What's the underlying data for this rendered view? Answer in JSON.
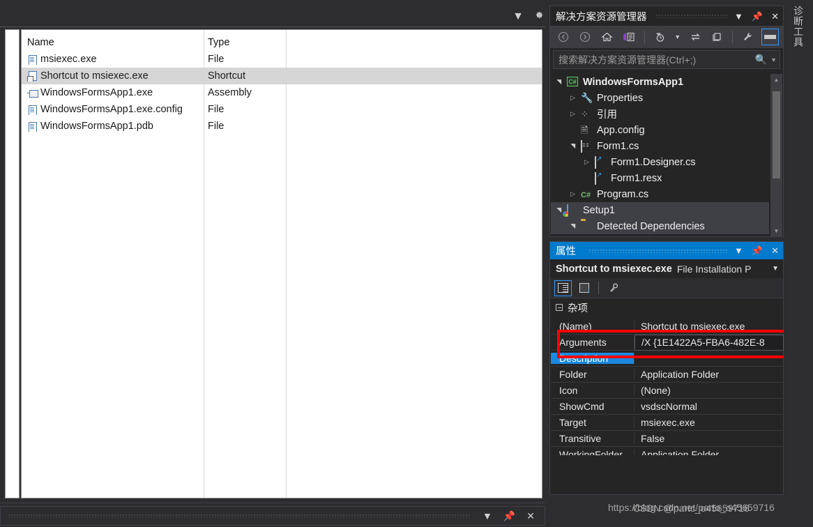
{
  "editor": {
    "columns": [
      "Name",
      "Type"
    ],
    "rows": [
      {
        "name": "msiexec.exe",
        "type": "File",
        "icon": "file-icon",
        "selected": false
      },
      {
        "name": "Shortcut to msiexec.exe",
        "type": "Shortcut",
        "icon": "shortcut-icon",
        "selected": true
      },
      {
        "name": "WindowsFormsApp1.exe",
        "type": "Assembly",
        "icon": "assembly-icon",
        "selected": false
      },
      {
        "name": "WindowsFormsApp1.exe.config",
        "type": "File",
        "icon": "file-icon",
        "selected": false
      },
      {
        "name": "WindowsFormsApp1.pdb",
        "type": "File",
        "icon": "file-icon",
        "selected": false
      }
    ]
  },
  "top_strip": {
    "dropdown_icon": "chevron-down-icon",
    "settings_icon": "gear-icon"
  },
  "bottom_bar": {
    "dropdown_icon": "chevron-down-icon",
    "pin_icon": "pin-icon",
    "close_icon": "close-icon"
  },
  "solution_explorer": {
    "title": "解决方案资源管理器",
    "title_icons": {
      "dropdown": "chevron-down-icon",
      "pin": "pin-icon",
      "close": "close-icon"
    },
    "toolbar": [
      {
        "name": "back-button",
        "glyph": "←"
      },
      {
        "name": "forward-button",
        "glyph": "→"
      },
      {
        "name": "home-button",
        "glyph": "home"
      },
      {
        "name": "solution-view-button",
        "glyph": "vs"
      },
      {
        "name": "pending-changes-button",
        "glyph": "clock"
      },
      {
        "name": "pending-changes-dropdown",
        "glyph": "▾"
      },
      {
        "name": "sync-with-active-document-button",
        "glyph": "⇆"
      },
      {
        "name": "refresh-button",
        "glyph": "copy"
      },
      {
        "name": "properties-button",
        "glyph": "wrench"
      },
      {
        "name": "preview-selected-items-button",
        "glyph": "bar"
      }
    ],
    "search_placeholder": "搜索解决方案资源管理器(Ctrl+;)",
    "search_icon": "search-icon",
    "search_dropdown_icon": "chevron-down-icon",
    "tree": [
      {
        "label": "WindowsFormsApp1",
        "indent": 0,
        "arrow": "expanded",
        "icon": "csharp-project-icon",
        "bold": true,
        "selected": false
      },
      {
        "label": "Properties",
        "indent": 1,
        "arrow": "collapsed",
        "icon": "wrench-icon",
        "bold": false,
        "selected": false
      },
      {
        "label": "引用",
        "indent": 1,
        "arrow": "collapsed",
        "icon": "references-icon",
        "bold": false,
        "selected": false
      },
      {
        "label": "App.config",
        "indent": 1,
        "arrow": "none",
        "icon": "config-file-icon",
        "bold": false,
        "selected": false
      },
      {
        "label": "Form1.cs",
        "indent": 1,
        "arrow": "expanded",
        "icon": "form-icon",
        "bold": false,
        "selected": false
      },
      {
        "label": "Form1.Designer.cs",
        "indent": 2,
        "arrow": "collapsed",
        "icon": "page-icon",
        "bold": false,
        "selected": false
      },
      {
        "label": "Form1.resx",
        "indent": 2,
        "arrow": "none",
        "icon": "page-icon",
        "bold": false,
        "selected": false
      },
      {
        "label": "Program.cs",
        "indent": 1,
        "arrow": "collapsed",
        "icon": "csharp-file-icon",
        "bold": false,
        "selected": false
      },
      {
        "label": "Setup1",
        "indent": 0,
        "arrow": "expanded",
        "icon": "setup-project-icon",
        "bold": false,
        "selected": true
      },
      {
        "label": "Detected Dependencies",
        "indent": 1,
        "arrow": "expanded",
        "icon": "folder-icon",
        "bold": false,
        "selected": true
      }
    ],
    "scrollbar": {
      "up_icon": "scroll-up-icon",
      "down_icon": "scroll-down-icon"
    }
  },
  "properties": {
    "title": "属性",
    "title_icons": {
      "dropdown": "chevron-down-icon",
      "pin": "pin-icon",
      "close": "close-icon"
    },
    "object_name": "Shortcut to msiexec.exe",
    "object_type": "File Installation P",
    "object_dropdown_icon": "chevron-down-icon",
    "toolbar": [
      {
        "name": "categorized-button",
        "glyph": "categorized"
      },
      {
        "name": "alphabetical-button",
        "glyph": "alphabetical"
      },
      {
        "name": "property-pages-button",
        "glyph": "key"
      }
    ],
    "category": "杂项",
    "category_expander_icon": "minus-box-icon",
    "rows": [
      {
        "key": "(Name)",
        "value": "Shortcut to msiexec.exe",
        "state": "normal"
      },
      {
        "key": "Arguments",
        "value": "/X {1E1422A5-FBA6-482E-8",
        "state": "editing"
      },
      {
        "key": "Description",
        "value": "",
        "state": "selected"
      },
      {
        "key": "Folder",
        "value": "Application Folder",
        "state": "normal"
      },
      {
        "key": "Icon",
        "value": "(None)",
        "state": "normal"
      },
      {
        "key": "ShowCmd",
        "value": "vsdscNormal",
        "state": "normal"
      },
      {
        "key": "Target",
        "value": "msiexec.exe",
        "state": "normal"
      },
      {
        "key": "Transitive",
        "value": "False",
        "state": "normal"
      },
      {
        "key": "WorkingFolder",
        "value": "Application Folder",
        "state": "normal"
      }
    ]
  },
  "vertical_tab": {
    "label": "诊断工具"
  },
  "watermarks": {
    "line1": "https://blog.csdn.net/parto_o45659716",
    "line2": "CSDN @partc_o45659716"
  },
  "colors": {
    "accent": "#007acc",
    "annotation": "#ff0000",
    "selection": "#1a8ae0",
    "panel_bg": "#252526",
    "app_bg": "#2d2d30"
  }
}
